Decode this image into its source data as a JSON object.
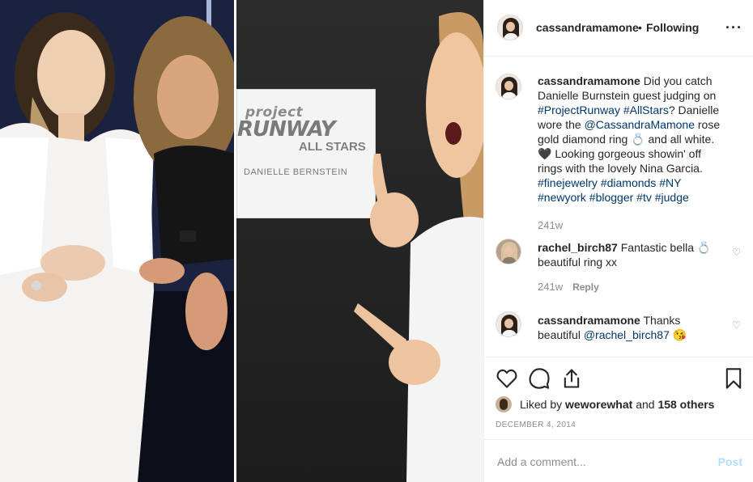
{
  "post": {
    "username": "cassandramamone",
    "separator": "•",
    "follow_status": "Following",
    "more_icon": "more-horizontal-icon"
  },
  "photo": {
    "sign": {
      "line1": "project",
      "line2": "RUNWAY",
      "line3": "ALL STARS",
      "line4": "DANIELLE BERNSTEIN"
    }
  },
  "caption": {
    "username": "cassandramamone",
    "part1": "Did you catch Danielle Burnstein guest judging on",
    "tag1": "#ProjectRunway",
    "tag2": "#AllStars",
    "part2": "? Danielle wore the",
    "tag3": "@CassandraMamone",
    "part3": "rose gold diamond ring 💍 and all white. 🖤 Looking gorgeous showin' off rings with the lovely Nina Garcia.",
    "tags": "#finejewelry #diamonds #NY #newyork #blogger #tv #judge",
    "time": "241w"
  },
  "comments": [
    {
      "username": "rachel_birch87",
      "text": "Fantastic bella 💍 beautiful ring xx",
      "time": "241w",
      "reply": "Reply"
    },
    {
      "username": "cassandramamone",
      "text_before": "Thanks beautiful",
      "mention": "@rachel_birch87",
      "emoji": "😘"
    }
  ],
  "actions": {
    "like_icon": "heart-icon",
    "comment_icon": "comment-icon",
    "share_icon": "share-icon",
    "save_icon": "bookmark-icon",
    "liked_by_prefix": "Liked by",
    "liked_by_user": "weworewhat",
    "liked_by_and": "and",
    "liked_by_others": "158 others",
    "date": "DECEMBER 4, 2014"
  },
  "add_comment": {
    "placeholder": "Add a comment...",
    "post_label": "Post"
  },
  "colors": {
    "link": "#00376b",
    "muted": "#8e8e8e",
    "post_disabled": "#b2dffc",
    "border": "#efefef"
  }
}
